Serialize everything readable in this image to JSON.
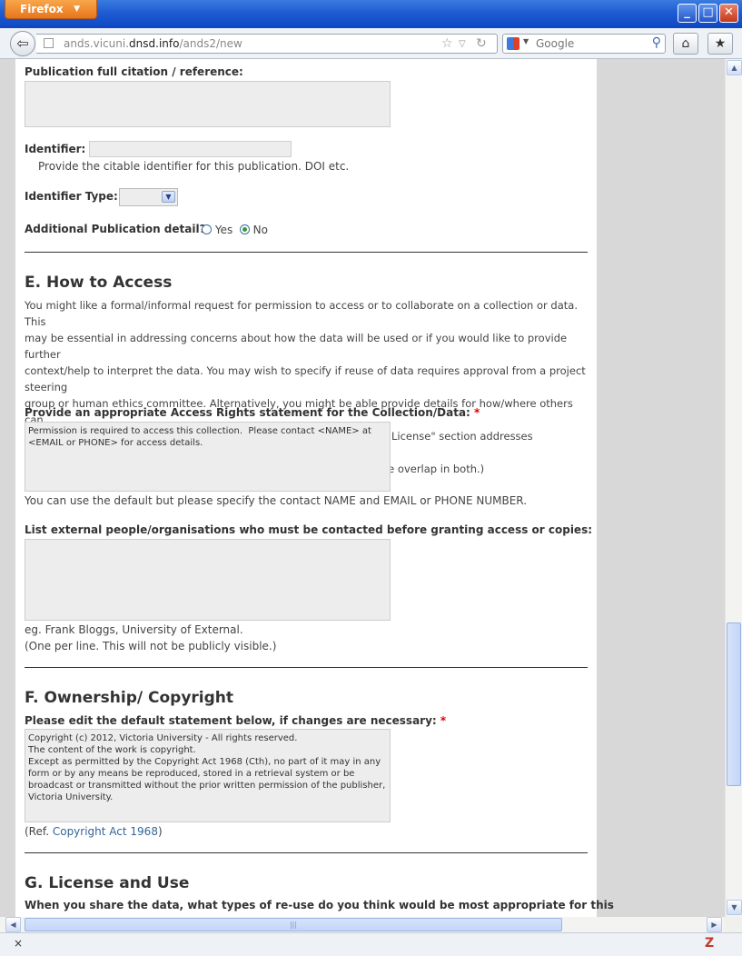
{
  "browser": {
    "app_button": "Firefox",
    "url_host_prefix": "ands.vicuni.",
    "url_host_domain": "dnsd.info",
    "url_path": "/ands2/new",
    "search_placeholder": "Google"
  },
  "form": {
    "citation_label": "Publication full citation / reference:",
    "identifier_label": "Identifier:",
    "identifier_help": "Provide the citable identifier for this publication. DOI etc.",
    "identifier_type_label": "Identifier Type:",
    "additional_detail_label": "Additional Publication detail?",
    "yes_label": "Yes",
    "no_label": "No",
    "selected_additional": "No"
  },
  "section_e": {
    "heading": "E. How to Access",
    "intro_lines": [
      "You might like a formal/informal request for permission to access or to collaborate on a collection or data. This",
      "may be essential in addressing concerns about how the data will be used or if you would like to provide further",
      "context/help to interpret the data. You may wish to specify if reuse of data requires approval from a project steering",
      "group or human ethics committee. Alternatively, you might be able provide details for how/where others can",
      "directly access the data or collections, if appropriate. (Note, that the \"License\" section addresses requirements on",
      "use, this section outlines how to gain access, and there could be some overlap in both.)"
    ],
    "access_rights_label": "Provide an appropriate Access Rights statement for the Collection/Data:",
    "required_mark": "*",
    "access_rights_value": "Permission is required to access this collection.  Please contact <NAME> at\n<EMAIL or PHONE> for access details.",
    "access_rights_help": "You can use the default but please specify the contact NAME and EMAIL or PHONE NUMBER.",
    "external_label": "List external people/organisations who must be contacted before granting access or copies:",
    "external_value": "",
    "external_help_1": "eg. Frank Bloggs, University of External.",
    "external_help_2": "(One per line. This will not be publicly visible.)"
  },
  "section_f": {
    "heading": "F. Ownership/ Copyright",
    "edit_label": "Please edit the default statement below, if changes are necessary:",
    "required_mark": "*",
    "copyright_value": "Copyright (c) 2012, Victoria University - All rights reserved.\nThe content of the work is copyright.\nExcept as permitted by the Copyright Act 1968 (Cth), no part of it may in any\nform or by any means be reproduced, stored in a retrieval system or be\nbroadcast or transmitted without the prior written permission of the publisher,\nVictoria University.",
    "ref_prefix": "(Ref. ",
    "ref_link": "Copyright Act 1968",
    "ref_suffix": ")"
  },
  "section_g": {
    "heading": "G. License and Use",
    "question": "When you share the data, what types of re-use do you think would be most appropriate for this"
  },
  "statusbar": {
    "close_glyph": "×",
    "addon_glyph": "Z"
  }
}
